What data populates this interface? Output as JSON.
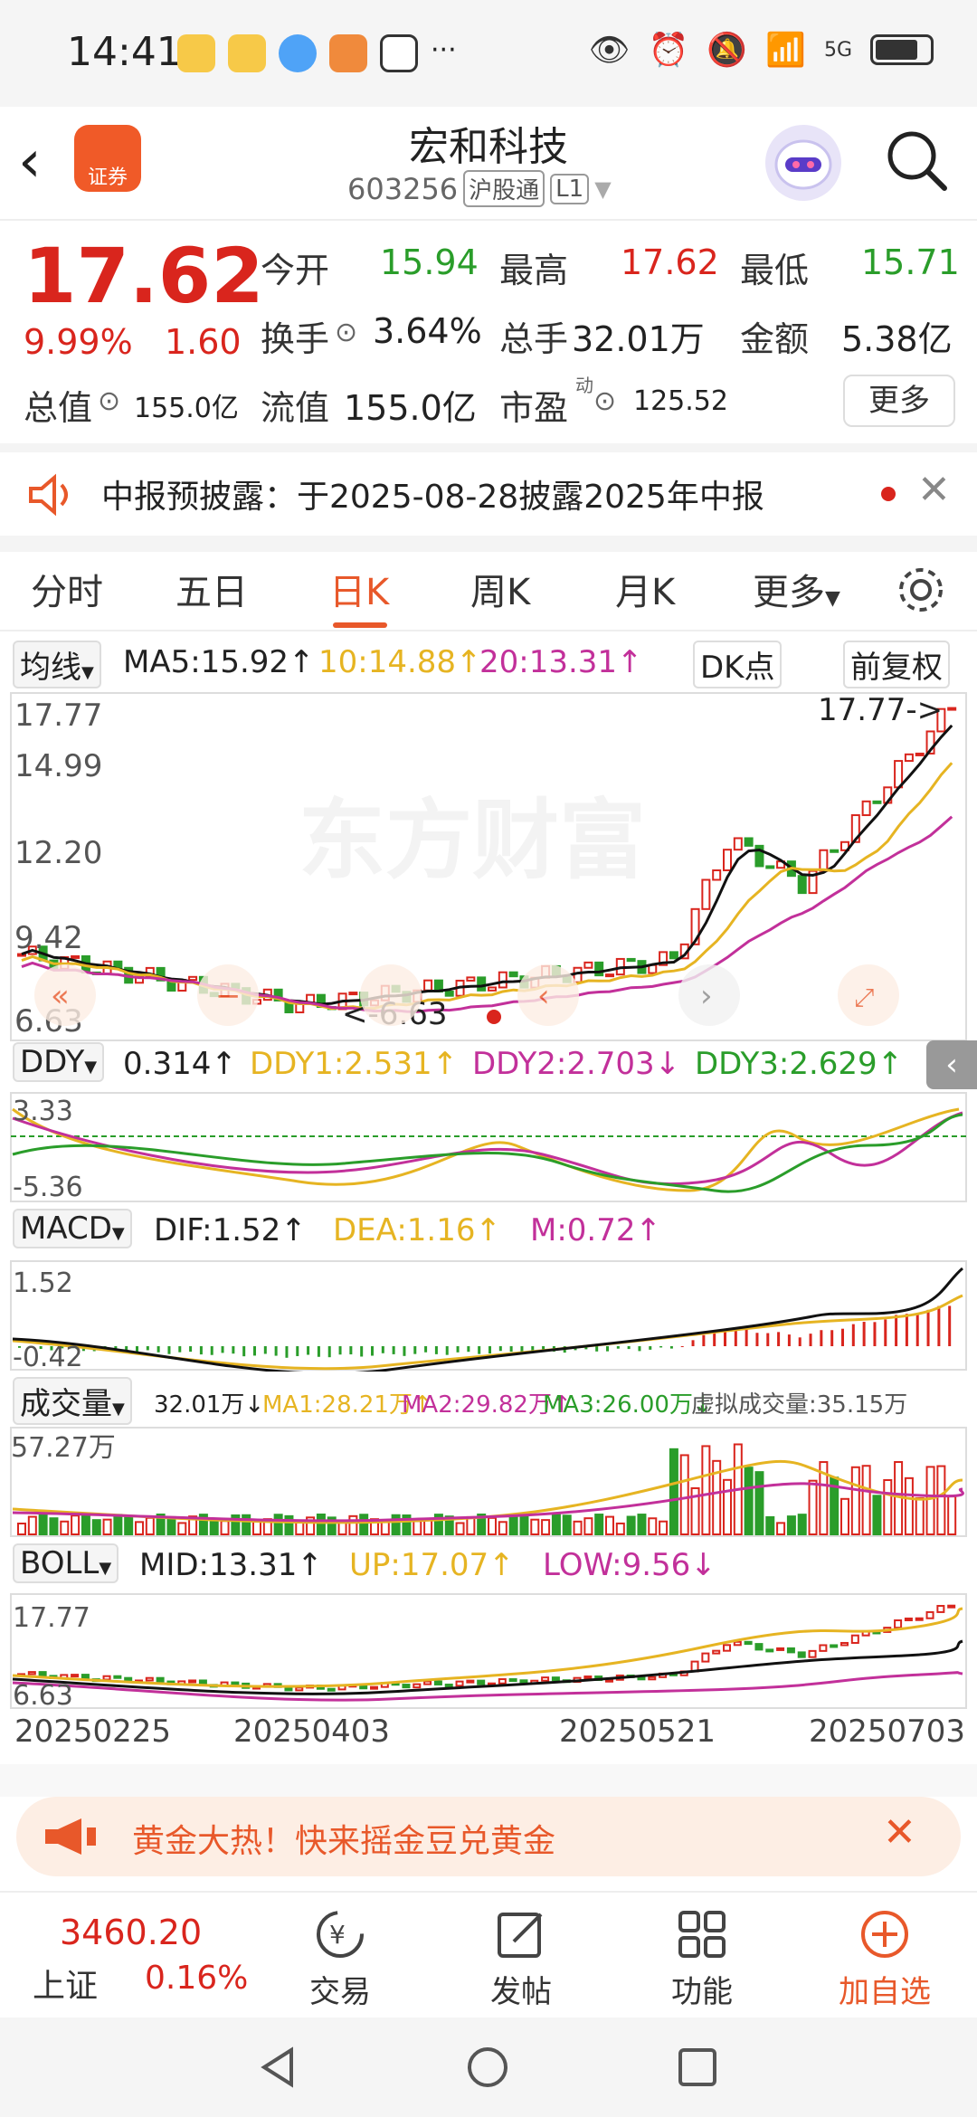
{
  "status": {
    "time": "14:41",
    "network": "5G"
  },
  "header": {
    "title": "宏和科技",
    "code": "603256",
    "tag1": "沪股通",
    "tag2": "L1",
    "logo": "证券"
  },
  "quote": {
    "price": "17.62",
    "pct": "9.99%",
    "change": "1.60",
    "open_label": "今开",
    "open": "15.94",
    "high_label": "最高",
    "high": "17.62",
    "low_label": "最低",
    "low": "15.71",
    "turnover_label": "换手",
    "turnover": "3.64%",
    "volume_label": "总手",
    "volume": "32.01万",
    "amount_label": "金额",
    "amount": "5.38亿",
    "mcap_label": "总值",
    "mcap": "155.0亿",
    "float_label": "流值",
    "float": "155.0亿",
    "pe_label": "市盈",
    "pe_sup": "动",
    "pe": "125.52",
    "more": "更多"
  },
  "notice": {
    "text": "中报预披露：于2025-08-28披露2025年中报"
  },
  "tabs": [
    "分时",
    "五日",
    "日K",
    "周K",
    "月K",
    "更多"
  ],
  "active_tab": "日K",
  "ma_bar": {
    "select": "均线",
    "ma5": "MA5:15.92↑",
    "ma10": "10:14.88↑",
    "ma20": "20:13.31↑",
    "dk": "DK点",
    "adjust": "前复权"
  },
  "kline": {
    "y_top": "17.77",
    "y2": "14.99",
    "y3": "12.20",
    "y4": "9.42",
    "y_bottom": "6.63",
    "max_marker": "17.77->",
    "min_marker": "<-6.63",
    "watermark": "东方财富"
  },
  "ddy": {
    "select": "DDY",
    "v": "0.314↑",
    "d1": "DDY1:2.531↑",
    "d2": "DDY2:2.703↓",
    "d3": "DDY3:2.629↑",
    "y_top": "3.33",
    "y_bottom": "-5.36"
  },
  "macd": {
    "select": "MACD",
    "dif": "DIF:1.52↑",
    "dea": "DEA:1.16↑",
    "m": "M:0.72↑",
    "y_top": "1.52",
    "y_bottom": "-0.42"
  },
  "vol": {
    "select": "成交量",
    "v": "32.01万↓",
    "ma1": "MA1:28.21万↑",
    "ma2": "MA2:29.82万↑",
    "ma3": "MA3:26.00万↓",
    "virtual": "虚拟成交量:35.15万",
    "y_top": "57.27万"
  },
  "boll": {
    "select": "BOLL",
    "mid": "MID:13.31↑",
    "up": "UP:17.07↑",
    "low": "LOW:9.56↓",
    "y_top": "17.77",
    "y_bottom": "6.63"
  },
  "dates": [
    "20250225",
    "20250403",
    "20250521",
    "20250703"
  ],
  "banner": {
    "text": "黄金大热！快来摇金豆兑黄金"
  },
  "bottom_nav": {
    "index_value": "3460.20",
    "index_name": "上证",
    "index_pct": "0.16%",
    "trade": "交易",
    "post": "发帖",
    "func": "功能",
    "add": "加自选"
  },
  "colors": {
    "up": "#d9251d",
    "down": "#2a9d2a",
    "accent": "#e8582a",
    "ma10": "#e6b422",
    "ma20": "#c2309a"
  }
}
